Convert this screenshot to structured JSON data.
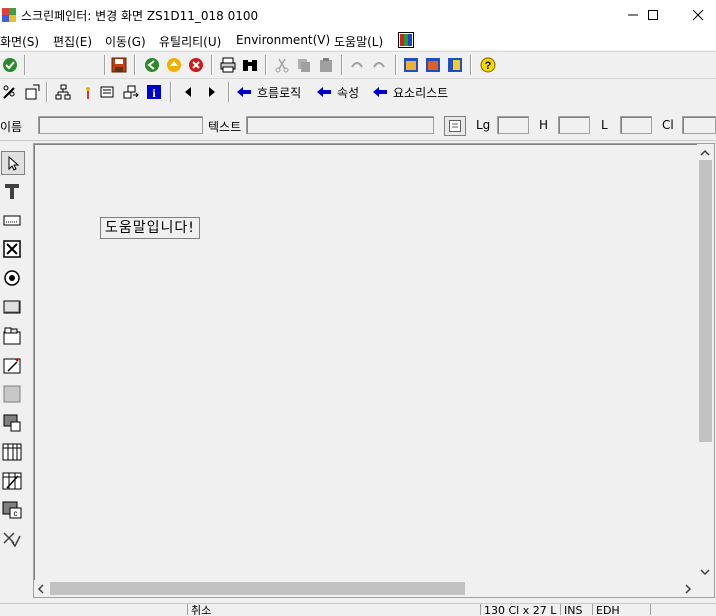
{
  "window": {
    "title": "스크린페인터:  변경 화면 ZS1D11_018 0100"
  },
  "menu": [
    "화면(S)",
    "편집(E)",
    "이동(G)",
    "유틸리티(U)",
    "Environment(V)",
    "도움말(L)"
  ],
  "toolbar2": {
    "flow_logic": "흐름로직",
    "attributes": "속성",
    "element_list": "요소리스트"
  },
  "attributes": {
    "name_label": "이름",
    "text_label": "텍스트",
    "lg_label": "Lg",
    "h_label": "H",
    "l_label": "L",
    "cl_label": "Cl"
  },
  "canvas": {
    "help_text": "도움말입니다!"
  },
  "status": {
    "cell1": "취소",
    "cell2": "130 Cl x 27 L",
    "cell3": "INS",
    "cell4": "EDH"
  },
  "colors": {
    "accent_blue": "#0000cc",
    "ok_green": "#2a8a2a",
    "cancel_red": "#cc1a1a",
    "help_yellow": "#f5d800"
  }
}
